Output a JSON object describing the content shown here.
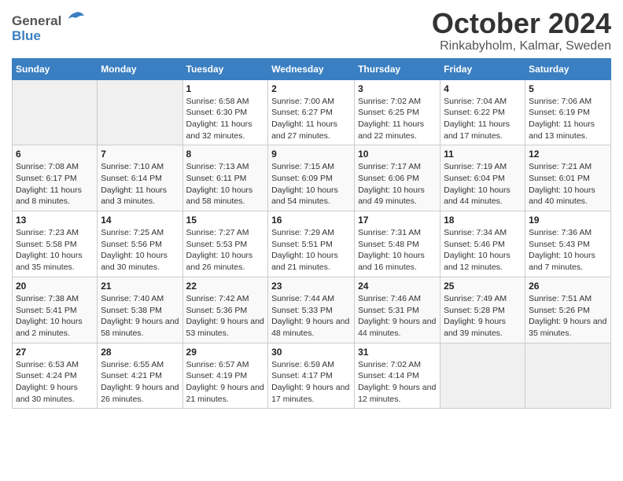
{
  "logo": {
    "general": "General",
    "blue": "Blue"
  },
  "title": "October 2024",
  "subtitle": "Rinkabyholm, Kalmar, Sweden",
  "days_header": [
    "Sunday",
    "Monday",
    "Tuesday",
    "Wednesday",
    "Thursday",
    "Friday",
    "Saturday"
  ],
  "weeks": [
    [
      {
        "num": "",
        "sunrise": "",
        "sunset": "",
        "daylight": "",
        "empty": true
      },
      {
        "num": "",
        "sunrise": "",
        "sunset": "",
        "daylight": "",
        "empty": true
      },
      {
        "num": "1",
        "sunrise": "Sunrise: 6:58 AM",
        "sunset": "Sunset: 6:30 PM",
        "daylight": "Daylight: 11 hours and 32 minutes.",
        "empty": false
      },
      {
        "num": "2",
        "sunrise": "Sunrise: 7:00 AM",
        "sunset": "Sunset: 6:27 PM",
        "daylight": "Daylight: 11 hours and 27 minutes.",
        "empty": false
      },
      {
        "num": "3",
        "sunrise": "Sunrise: 7:02 AM",
        "sunset": "Sunset: 6:25 PM",
        "daylight": "Daylight: 11 hours and 22 minutes.",
        "empty": false
      },
      {
        "num": "4",
        "sunrise": "Sunrise: 7:04 AM",
        "sunset": "Sunset: 6:22 PM",
        "daylight": "Daylight: 11 hours and 17 minutes.",
        "empty": false
      },
      {
        "num": "5",
        "sunrise": "Sunrise: 7:06 AM",
        "sunset": "Sunset: 6:19 PM",
        "daylight": "Daylight: 11 hours and 13 minutes.",
        "empty": false
      }
    ],
    [
      {
        "num": "6",
        "sunrise": "Sunrise: 7:08 AM",
        "sunset": "Sunset: 6:17 PM",
        "daylight": "Daylight: 11 hours and 8 minutes.",
        "empty": false
      },
      {
        "num": "7",
        "sunrise": "Sunrise: 7:10 AM",
        "sunset": "Sunset: 6:14 PM",
        "daylight": "Daylight: 11 hours and 3 minutes.",
        "empty": false
      },
      {
        "num": "8",
        "sunrise": "Sunrise: 7:13 AM",
        "sunset": "Sunset: 6:11 PM",
        "daylight": "Daylight: 10 hours and 58 minutes.",
        "empty": false
      },
      {
        "num": "9",
        "sunrise": "Sunrise: 7:15 AM",
        "sunset": "Sunset: 6:09 PM",
        "daylight": "Daylight: 10 hours and 54 minutes.",
        "empty": false
      },
      {
        "num": "10",
        "sunrise": "Sunrise: 7:17 AM",
        "sunset": "Sunset: 6:06 PM",
        "daylight": "Daylight: 10 hours and 49 minutes.",
        "empty": false
      },
      {
        "num": "11",
        "sunrise": "Sunrise: 7:19 AM",
        "sunset": "Sunset: 6:04 PM",
        "daylight": "Daylight: 10 hours and 44 minutes.",
        "empty": false
      },
      {
        "num": "12",
        "sunrise": "Sunrise: 7:21 AM",
        "sunset": "Sunset: 6:01 PM",
        "daylight": "Daylight: 10 hours and 40 minutes.",
        "empty": false
      }
    ],
    [
      {
        "num": "13",
        "sunrise": "Sunrise: 7:23 AM",
        "sunset": "Sunset: 5:58 PM",
        "daylight": "Daylight: 10 hours and 35 minutes.",
        "empty": false
      },
      {
        "num": "14",
        "sunrise": "Sunrise: 7:25 AM",
        "sunset": "Sunset: 5:56 PM",
        "daylight": "Daylight: 10 hours and 30 minutes.",
        "empty": false
      },
      {
        "num": "15",
        "sunrise": "Sunrise: 7:27 AM",
        "sunset": "Sunset: 5:53 PM",
        "daylight": "Daylight: 10 hours and 26 minutes.",
        "empty": false
      },
      {
        "num": "16",
        "sunrise": "Sunrise: 7:29 AM",
        "sunset": "Sunset: 5:51 PM",
        "daylight": "Daylight: 10 hours and 21 minutes.",
        "empty": false
      },
      {
        "num": "17",
        "sunrise": "Sunrise: 7:31 AM",
        "sunset": "Sunset: 5:48 PM",
        "daylight": "Daylight: 10 hours and 16 minutes.",
        "empty": false
      },
      {
        "num": "18",
        "sunrise": "Sunrise: 7:34 AM",
        "sunset": "Sunset: 5:46 PM",
        "daylight": "Daylight: 10 hours and 12 minutes.",
        "empty": false
      },
      {
        "num": "19",
        "sunrise": "Sunrise: 7:36 AM",
        "sunset": "Sunset: 5:43 PM",
        "daylight": "Daylight: 10 hours and 7 minutes.",
        "empty": false
      }
    ],
    [
      {
        "num": "20",
        "sunrise": "Sunrise: 7:38 AM",
        "sunset": "Sunset: 5:41 PM",
        "daylight": "Daylight: 10 hours and 2 minutes.",
        "empty": false
      },
      {
        "num": "21",
        "sunrise": "Sunrise: 7:40 AM",
        "sunset": "Sunset: 5:38 PM",
        "daylight": "Daylight: 9 hours and 58 minutes.",
        "empty": false
      },
      {
        "num": "22",
        "sunrise": "Sunrise: 7:42 AM",
        "sunset": "Sunset: 5:36 PM",
        "daylight": "Daylight: 9 hours and 53 minutes.",
        "empty": false
      },
      {
        "num": "23",
        "sunrise": "Sunrise: 7:44 AM",
        "sunset": "Sunset: 5:33 PM",
        "daylight": "Daylight: 9 hours and 48 minutes.",
        "empty": false
      },
      {
        "num": "24",
        "sunrise": "Sunrise: 7:46 AM",
        "sunset": "Sunset: 5:31 PM",
        "daylight": "Daylight: 9 hours and 44 minutes.",
        "empty": false
      },
      {
        "num": "25",
        "sunrise": "Sunrise: 7:49 AM",
        "sunset": "Sunset: 5:28 PM",
        "daylight": "Daylight: 9 hours and 39 minutes.",
        "empty": false
      },
      {
        "num": "26",
        "sunrise": "Sunrise: 7:51 AM",
        "sunset": "Sunset: 5:26 PM",
        "daylight": "Daylight: 9 hours and 35 minutes.",
        "empty": false
      }
    ],
    [
      {
        "num": "27",
        "sunrise": "Sunrise: 6:53 AM",
        "sunset": "Sunset: 4:24 PM",
        "daylight": "Daylight: 9 hours and 30 minutes.",
        "empty": false
      },
      {
        "num": "28",
        "sunrise": "Sunrise: 6:55 AM",
        "sunset": "Sunset: 4:21 PM",
        "daylight": "Daylight: 9 hours and 26 minutes.",
        "empty": false
      },
      {
        "num": "29",
        "sunrise": "Sunrise: 6:57 AM",
        "sunset": "Sunset: 4:19 PM",
        "daylight": "Daylight: 9 hours and 21 minutes.",
        "empty": false
      },
      {
        "num": "30",
        "sunrise": "Sunrise: 6:59 AM",
        "sunset": "Sunset: 4:17 PM",
        "daylight": "Daylight: 9 hours and 17 minutes.",
        "empty": false
      },
      {
        "num": "31",
        "sunrise": "Sunrise: 7:02 AM",
        "sunset": "Sunset: 4:14 PM",
        "daylight": "Daylight: 9 hours and 12 minutes.",
        "empty": false
      },
      {
        "num": "",
        "sunrise": "",
        "sunset": "",
        "daylight": "",
        "empty": true
      },
      {
        "num": "",
        "sunrise": "",
        "sunset": "",
        "daylight": "",
        "empty": true
      }
    ]
  ]
}
